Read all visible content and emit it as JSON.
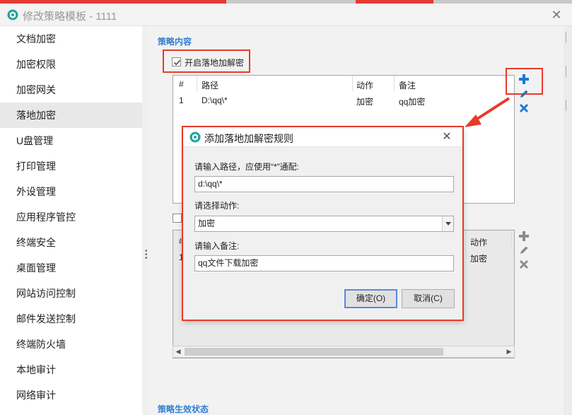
{
  "window": {
    "title": "修改策略模板 - 1111",
    "close_glyph": "✕"
  },
  "sidebar": {
    "items": [
      {
        "label": "文档加密"
      },
      {
        "label": "加密权限"
      },
      {
        "label": "加密网关"
      },
      {
        "label": "落地加密",
        "active": true
      },
      {
        "label": "U盘管理"
      },
      {
        "label": "打印管理"
      },
      {
        "label": "外设管理"
      },
      {
        "label": "应用程序管控"
      },
      {
        "label": "终端安全"
      },
      {
        "label": "桌面管理"
      },
      {
        "label": "网站访问控制"
      },
      {
        "label": "邮件发送控制"
      },
      {
        "label": "终端防火墙"
      },
      {
        "label": "本地审计"
      },
      {
        "label": "网络审计"
      }
    ]
  },
  "main": {
    "strategy_section_title": "策略内容",
    "enable_checkbox": {
      "label": "开启落地加解密",
      "checked": true
    },
    "rules_table": {
      "columns": [
        "#",
        "路径",
        "动作",
        "备注"
      ],
      "rows": [
        [
          "1",
          "D:\\qq\\*",
          "加密",
          "qq加密"
        ]
      ]
    },
    "second_table": {
      "visible_header_fragment": "#",
      "visible_col_action": "动作",
      "visible_row_index": "1",
      "visible_row_action": "加密"
    },
    "status_section_title": "策略生效状态"
  },
  "icons": {
    "add": "plus-icon",
    "edit": "pencil-icon",
    "delete": "cross-icon",
    "accent_blue": "#1e78d6",
    "highlight_red": "#e83a2a"
  },
  "dialog": {
    "title": "添加落地加解密规则",
    "path_label": "请输入路径，应使用“*”通配:",
    "path_value": "d:\\qq\\*",
    "action_label": "请选择动作:",
    "action_value": "加密",
    "note_label": "请输入备注:",
    "note_value": "qq文件下载加密",
    "ok_label": "确定(O)",
    "cancel_label": "取消(C)"
  }
}
